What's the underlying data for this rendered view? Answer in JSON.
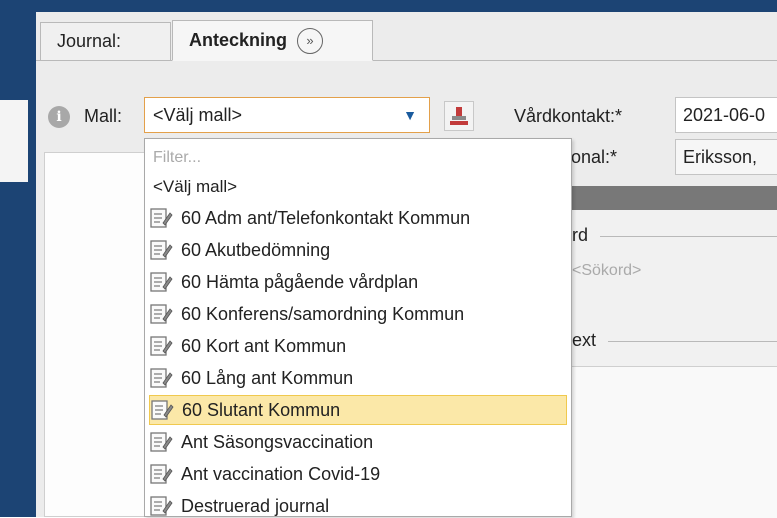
{
  "tabs": [
    {
      "label": "Journal:"
    },
    {
      "label": "Anteckning"
    }
  ],
  "form": {
    "mall_label": "Mall:",
    "mall_value": "<Välj mall>",
    "vardkontakt_label": "Vårdkontakt:*",
    "vardkontakt_value": "2021-06-0",
    "personal_label": "personal:*",
    "personal_value": "Eriksson,"
  },
  "right_panel": {
    "sokord_title": "rd",
    "sokord_placeholder": "<Sökord>",
    "fritext_title": "ext"
  },
  "dropdown": {
    "filter_placeholder": "Filter...",
    "default_option": "<Välj mall>",
    "options": [
      "60 Adm ant/Telefonkontakt Kommun",
      "60 Akutbedömning",
      "60 Hämta pågående vårdplan",
      "60 Konferens/samordning Kommun",
      "60 Kort ant Kommun",
      "60 Lång ant Kommun",
      "60 Slutant Kommun",
      "Ant Säsongsvaccination",
      "Ant vaccination Covid-19",
      "Destruerad journal"
    ],
    "selected_option": "60 Slutant Kommun"
  },
  "colors": {
    "frame_blue": "#1c4474",
    "select_border": "#e3a04a",
    "highlight": "#fbe8a8"
  },
  "icons": {
    "info": "info-icon",
    "next": "double-chevron-icon",
    "stamp": "stamp-icon",
    "option": "note-document-icon",
    "dropdown_arrow": "triangle-down-icon"
  }
}
